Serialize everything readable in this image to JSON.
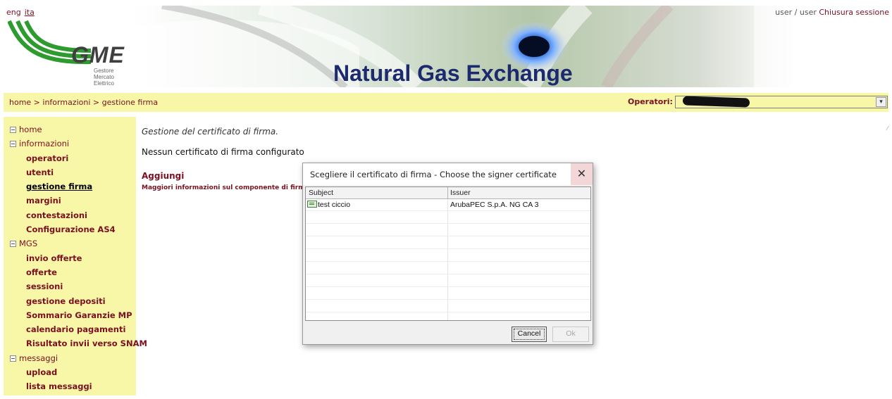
{
  "header": {
    "languages": [
      {
        "label": "eng",
        "active": false
      },
      {
        "label": "ita",
        "active": true
      }
    ],
    "logo_name": "GME",
    "logo_sub": [
      "Gestore",
      "Mercato",
      "Elettrico"
    ],
    "banner_title": "Natural Gas Exchange",
    "user_text": "user / user",
    "logout_label": "Chiusura sessione"
  },
  "breadcrumb": "home > informazioni > gestione firma",
  "operator": {
    "label": "Operatori:",
    "value_redacted": true
  },
  "sidebar": [
    {
      "label": "home",
      "level": 0,
      "expander": true
    },
    {
      "label": "informazioni",
      "level": 0,
      "expander": true
    },
    {
      "label": "operatori",
      "level": 1
    },
    {
      "label": "utenti",
      "level": 1
    },
    {
      "label": "gestione firma",
      "level": 1,
      "current": true
    },
    {
      "label": "margini",
      "level": 1
    },
    {
      "label": "contestazioni",
      "level": 1
    },
    {
      "label": "Configurazione AS4",
      "level": 1
    },
    {
      "label": "MGS",
      "level": 0,
      "expander": true
    },
    {
      "label": "invio offerte",
      "level": 1
    },
    {
      "label": "offerte",
      "level": 1
    },
    {
      "label": "sessioni",
      "level": 1
    },
    {
      "label": "gestione depositi",
      "level": 1
    },
    {
      "label": "Sommario Garanzie MP",
      "level": 1
    },
    {
      "label": "calendario pagamenti",
      "level": 1
    },
    {
      "label": "Risultato invii verso SNAM",
      "level": 1
    },
    {
      "label": "messaggi",
      "level": 0,
      "expander": true
    },
    {
      "label": "upload",
      "level": 1
    },
    {
      "label": "lista messaggi",
      "level": 1
    }
  ],
  "main": {
    "title": "Gestione del certificato di firma.",
    "status": "Nessun certificato di firma configurato",
    "add_link": "Aggiungi",
    "info_link": "Maggiori informazioni sul componente di firma"
  },
  "dialog": {
    "title": "Scegliere il certificato di firma - Choose the signer certificate",
    "close_glyph": "✕",
    "columns": [
      "Subject",
      "Issuer"
    ],
    "rows": [
      {
        "subject": "test ciccio",
        "issuer": "ArubaPEC S.p.A. NG CA 3"
      }
    ],
    "cancel_label": "Cancel",
    "ok_label": "Ok"
  },
  "colors": {
    "accent_yellow": "#f8f7a8",
    "link_maroon": "#7a1020",
    "title_navy": "#1d2b6e",
    "logo_green": "#2e9b2e"
  }
}
